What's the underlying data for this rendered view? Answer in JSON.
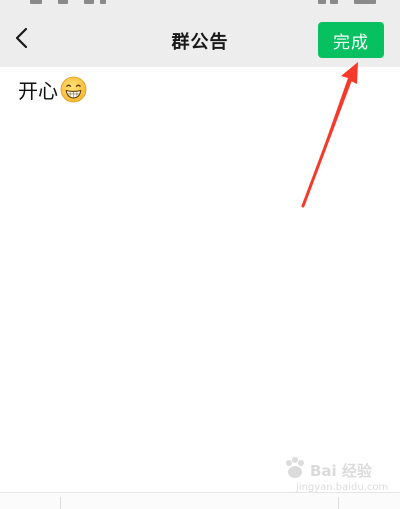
{
  "header": {
    "title": "群公告",
    "done_label": "完成",
    "back_icon": "chevron-left-icon"
  },
  "editor": {
    "content": "开心",
    "emoji_icon": "grinning-face-emoji-icon"
  },
  "annotation": {
    "arrow_color": "#f5392a"
  },
  "watermark": {
    "brand": "Bai 经验",
    "url": "jingyan.baidu.com"
  },
  "colors": {
    "accent": "#07c160",
    "nav_background": "#ededed"
  }
}
